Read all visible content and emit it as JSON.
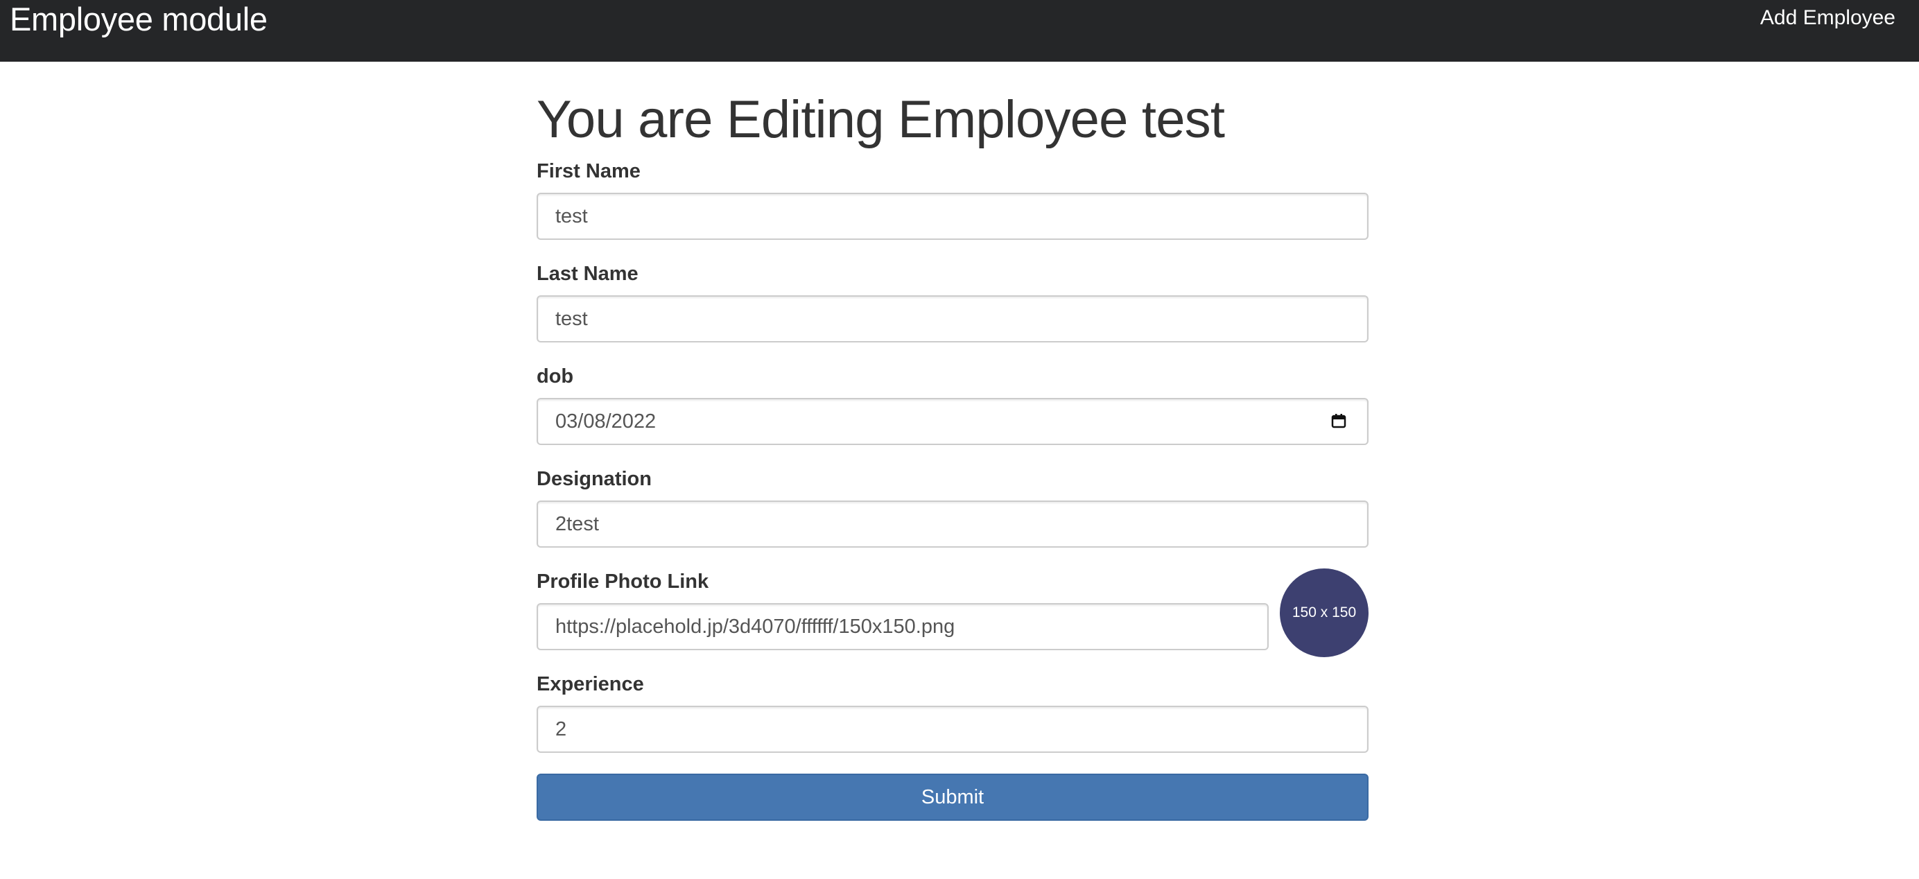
{
  "navbar": {
    "brand": "Employee module",
    "link": "Add Employee"
  },
  "page": {
    "title": "You are Editing Employee test"
  },
  "form": {
    "first_name": {
      "label": "First Name",
      "value": "test"
    },
    "last_name": {
      "label": "Last Name",
      "value": "test"
    },
    "dob": {
      "label": "dob",
      "value": "03/08/2022",
      "icon": "calendar-icon"
    },
    "designation": {
      "label": "Designation",
      "value": "2test"
    },
    "profile_photo": {
      "label": "Profile Photo Link",
      "value": "https://placehold.jp/3d4070/ffffff/150x150.png",
      "preview_text": "150 x 150",
      "preview_color": "#3d4070"
    },
    "experience": {
      "label": "Experience",
      "value": "2"
    },
    "submit_label": "Submit"
  },
  "colors": {
    "navbar_bg": "#252628",
    "submit_bg": "#4677b1"
  }
}
